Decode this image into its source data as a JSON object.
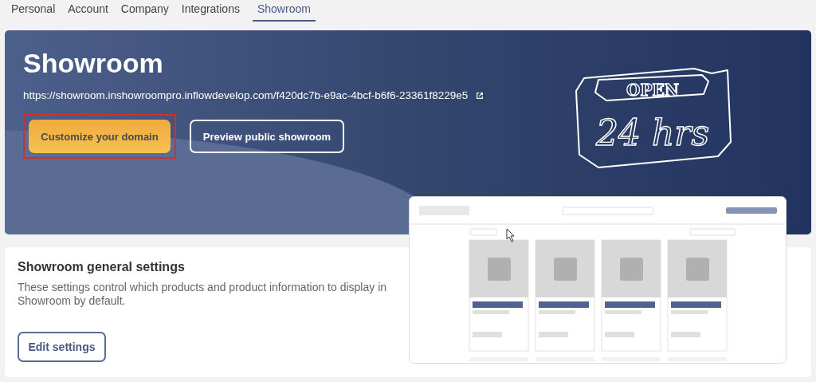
{
  "tabs": [
    {
      "label": "Personal",
      "selected": false
    },
    {
      "label": "Account",
      "selected": false
    },
    {
      "label": "Company",
      "selected": false
    },
    {
      "label": "Integrations",
      "selected": false
    },
    {
      "label": "Showroom",
      "selected": true
    }
  ],
  "hero": {
    "title": "Showroom",
    "url": "https://showroom.inshowroompro.inflowdevelop.com/f420dc7b-e9ac-4bcf-b6f6-23361f8229e5",
    "buttons": [
      {
        "label": "Customize your domain",
        "kind": "primary",
        "highlighted": true
      },
      {
        "label": "Preview public showroom",
        "kind": "outline",
        "highlighted": false
      }
    ],
    "sign": {
      "line_1": "OPEN",
      "line_2": "24 hrs"
    }
  },
  "settings": {
    "title": "Showroom general settings",
    "description": "These settings control which products and product information to display in Showroom by default.",
    "button": "Edit settings"
  }
}
